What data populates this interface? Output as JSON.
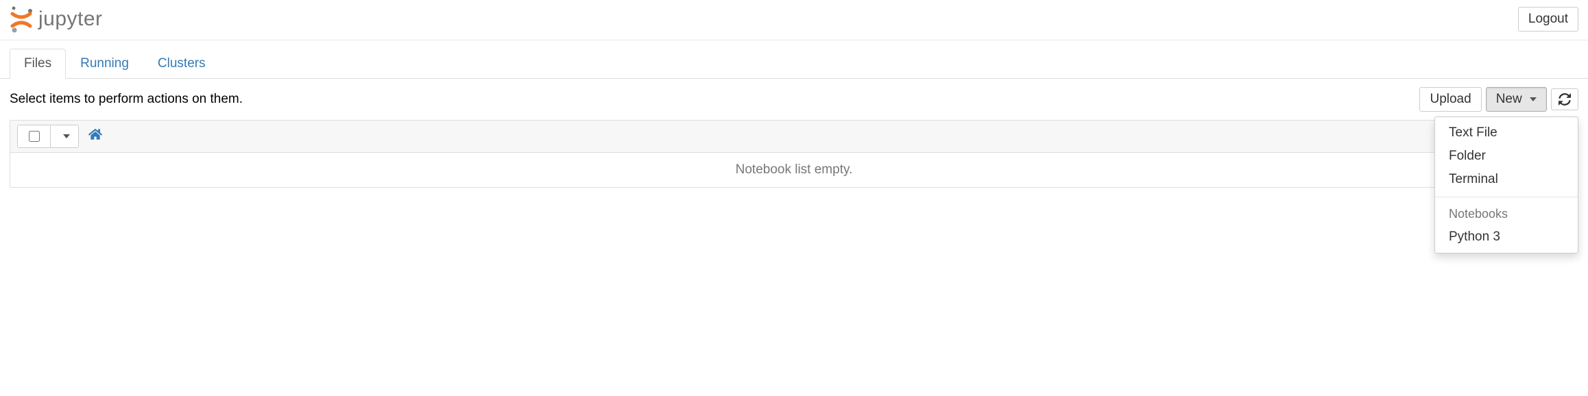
{
  "header": {
    "logo_text": "jupyter",
    "logout_label": "Logout"
  },
  "tabs": [
    {
      "label": "Files",
      "active": true
    },
    {
      "label": "Running",
      "active": false
    },
    {
      "label": "Clusters",
      "active": false
    }
  ],
  "action_row": {
    "message": "Select items to perform actions on them.",
    "upload_label": "Upload",
    "new_label": "New"
  },
  "list": {
    "empty_message": "Notebook list empty."
  },
  "new_menu": {
    "items": [
      {
        "label": "Text File"
      },
      {
        "label": "Folder"
      },
      {
        "label": "Terminal"
      }
    ],
    "section_header": "Notebooks",
    "section_items": [
      {
        "label": "Python 3"
      }
    ]
  }
}
